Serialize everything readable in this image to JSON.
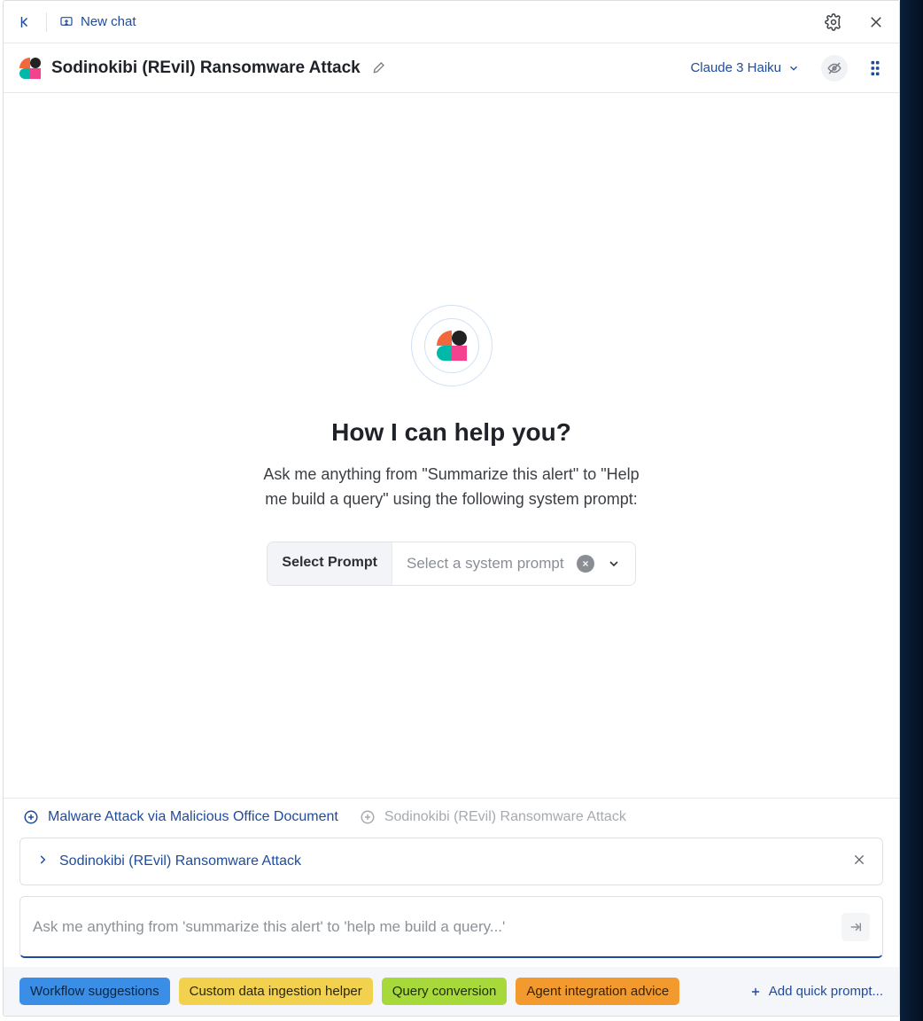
{
  "topbar": {
    "new_chat": "New chat"
  },
  "header": {
    "title": "Sodinokibi (REvil) Ransomware Attack",
    "model": "Claude 3 Haiku"
  },
  "main": {
    "headline": "How I can help you?",
    "subtext": "Ask me anything from \"Summarize this alert\" to \"Help me build a query\" using the following system prompt:",
    "prompt_label": "Select Prompt",
    "prompt_placeholder": "Select a system prompt"
  },
  "context_tabs": [
    {
      "label": "Malware Attack via Malicious Office Document",
      "active": true
    },
    {
      "label": "Sodinokibi (REvil) Ransomware Attack",
      "active": false
    }
  ],
  "banner": {
    "text": "Sodinokibi (REvil) Ransomware Attack"
  },
  "input": {
    "placeholder": "Ask me anything from 'summarize this alert' to 'help me build a query...'"
  },
  "chips": [
    {
      "label": "Workflow suggestions",
      "variant": "blue"
    },
    {
      "label": "Custom data ingestion helper",
      "variant": "yellow"
    },
    {
      "label": "Query conversion",
      "variant": "green"
    },
    {
      "label": "Agent integration advice",
      "variant": "orange"
    }
  ],
  "add_prompt": "Add quick prompt..."
}
